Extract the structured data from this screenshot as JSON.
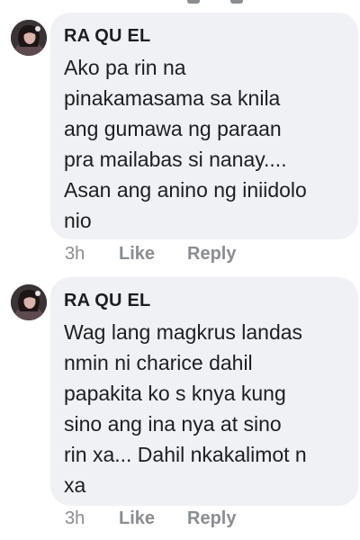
{
  "comments": [
    {
      "author": "RA QU EL",
      "text": "Ako pa rin na\npinakamasama sa knila\nang gumawa ng paraan\npra mailabas si nanay....\nAsan ang anino ng iniidolo\nnio",
      "time": "3h",
      "like_label": "Like",
      "reply_label": "Reply"
    },
    {
      "author": "RA QU EL",
      "text": "Wag lang magkrus landas\nnmin ni charice dahil\npapakita ko s knya kung\nsino ang ina nya at sino\nrin xa... Dahil nkakalimot n\nxa",
      "time": "3h",
      "like_label": "Like",
      "reply_label": "Reply"
    }
  ],
  "colors": {
    "bubble_bg": "#eff1f4",
    "text": "#1c1e21",
    "meta": "#8a8d91"
  },
  "icons": [
    "profile-avatar"
  ]
}
